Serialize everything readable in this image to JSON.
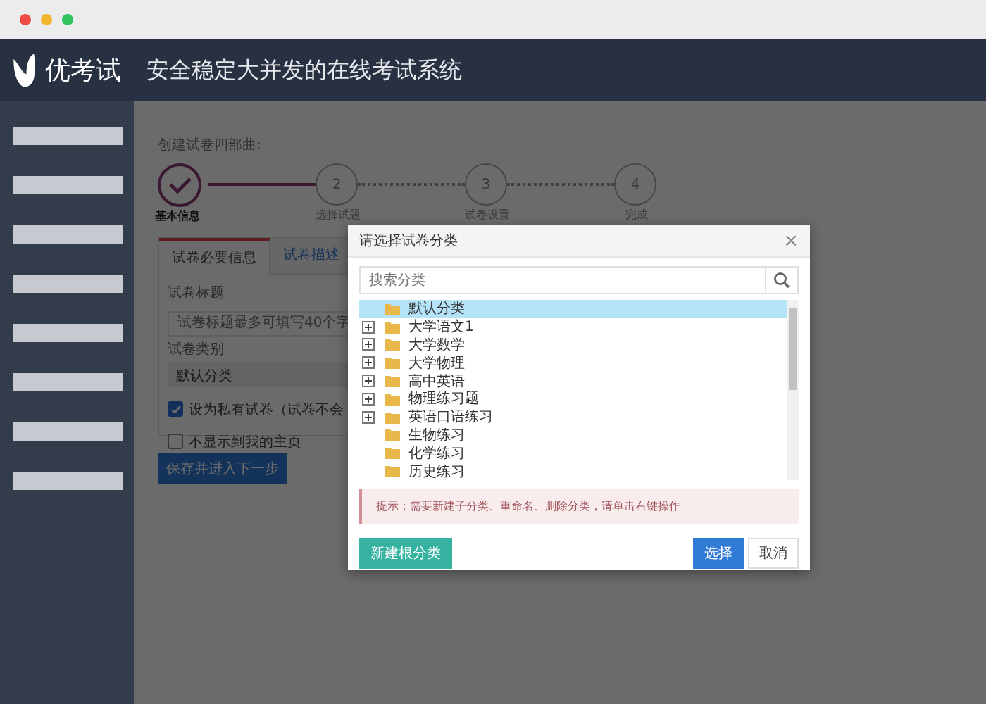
{
  "header": {
    "logo_text": "优考试",
    "tagline": "安全稳定大并发的在线考试系统"
  },
  "page": {
    "heading": "创建试卷四部曲:",
    "steps": [
      {
        "label": "基本信息",
        "done": true
      },
      {
        "label": "选择试题",
        "number": "2",
        "done": false
      },
      {
        "label": "试卷设置",
        "number": "3",
        "done": false
      },
      {
        "label": "完成",
        "number": "4",
        "done": false
      }
    ],
    "tabs": [
      {
        "label": "试卷必要信息",
        "selected": true
      },
      {
        "label": "试卷描述",
        "selected": false
      }
    ],
    "title_label": "试卷标题",
    "title_placeholder": "试卷标题最多可填写40个字",
    "category_label": "试卷类别",
    "category_value": "默认分类",
    "checkboxes": [
      {
        "label": "设为私有试卷（试卷不会",
        "checked": true
      },
      {
        "label": "不显示到我的主页",
        "checked": false
      }
    ],
    "save_button": "保存并进入下一步"
  },
  "dialog": {
    "title": "请选择试卷分类",
    "close": "×",
    "search_placeholder": "搜索分类",
    "tree": [
      {
        "label": "默认分类",
        "has_children": false,
        "selected": true
      },
      {
        "label": "大学语文1",
        "has_children": true,
        "selected": false
      },
      {
        "label": "大学数学",
        "has_children": true,
        "selected": false
      },
      {
        "label": "大学物理",
        "has_children": true,
        "selected": false
      },
      {
        "label": "高中英语",
        "has_children": true,
        "selected": false
      },
      {
        "label": "物理练习题",
        "has_children": true,
        "selected": false
      },
      {
        "label": "英语口语练习",
        "has_children": true,
        "selected": false
      },
      {
        "label": "生物练习",
        "has_children": false,
        "selected": false
      },
      {
        "label": "化学练习",
        "has_children": false,
        "selected": false
      },
      {
        "label": "历史练习",
        "has_children": false,
        "selected": false
      }
    ],
    "hint": "提示：需要新建子分类、重命名、删除分类，请单击右键操作",
    "new_root_button": "新建根分类",
    "select_button": "选择",
    "cancel_button": "取消"
  }
}
